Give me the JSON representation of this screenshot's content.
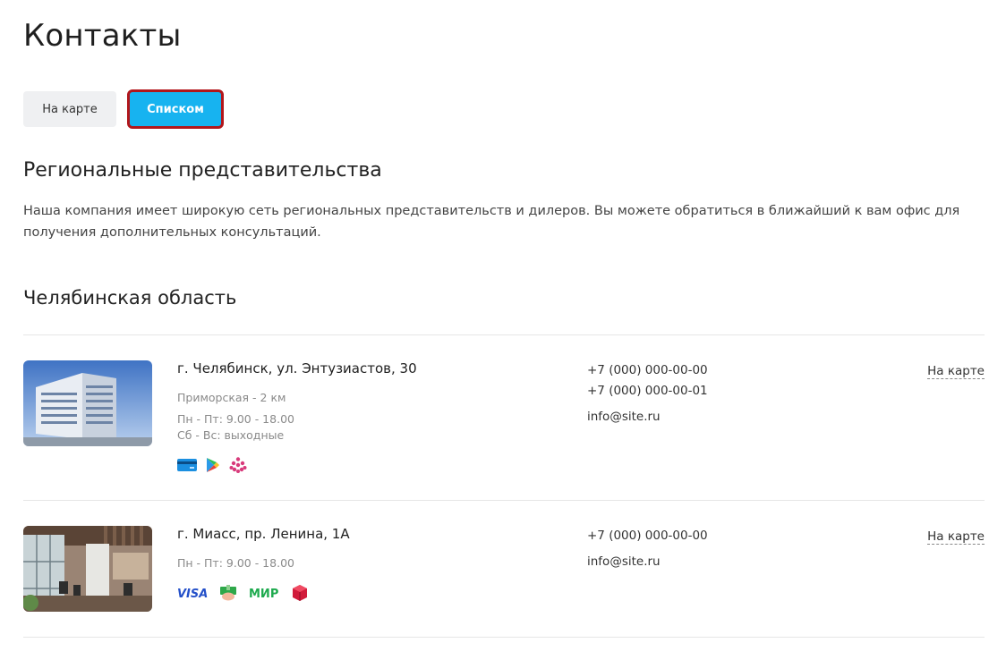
{
  "page": {
    "title": "Контакты"
  },
  "view_toggle": {
    "map_label": "На карте",
    "list_label": "Списком"
  },
  "regional": {
    "title": "Региональные представительства",
    "text": "Наша компания имеет широкую сеть региональных представительств и дилеров. Вы можете обратиться в ближайший к вам офис для получения дополнительных консультаций."
  },
  "region": {
    "title": "Челябинская область"
  },
  "offices": [
    {
      "address": "г. Челябинск, ул. Энтузиастов, 30",
      "metro": "Приморская - 2 км",
      "hours_weekdays": "Пн - Пт: 9.00 - 18.00",
      "hours_weekend": "Сб - Вс: выходные",
      "phones": [
        "+7 (000) 000-00-00",
        "+7 (000) 000-00-01"
      ],
      "email": "info@site.ru",
      "map_link": "На карте",
      "payment_icons": [
        "card-icon",
        "google-play-icon",
        "grid-flower-icon"
      ]
    },
    {
      "address": "г. Миасс, пр. Ленина, 1А",
      "hours_weekdays": "Пн - Пт: 9.00 - 18.00",
      "phones": [
        "+7 (000) 000-00-00"
      ],
      "email": "info@site.ru",
      "map_link": "На карте",
      "payment_icons": [
        "visa-icon",
        "cash-hand-icon",
        "mir-icon",
        "box-icon"
      ],
      "payment_text": {
        "visa": "VISA",
        "mir": "МИР"
      }
    }
  ],
  "colors": {
    "accent": "#17b3f0",
    "active_outline": "#b2161b",
    "muted": "#8a8a8a"
  }
}
